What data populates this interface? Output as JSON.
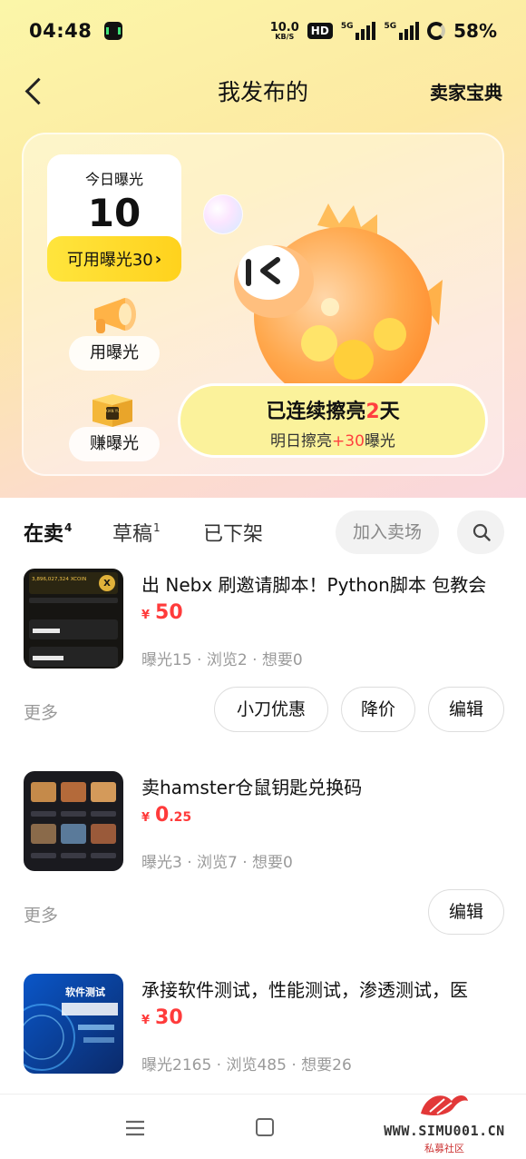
{
  "status_bar": {
    "time": "04:48",
    "net_speed_value": "10.0",
    "net_speed_unit": "KB/S",
    "hd_badge": "HD",
    "signal1_label": "5G",
    "signal2_label": "5G",
    "battery": "58%"
  },
  "nav": {
    "title": "我发布的",
    "seller_guide": "卖家宝典"
  },
  "promo": {
    "today_label": "今日曝光",
    "today_value": "10",
    "available_label": "可用曝光30",
    "available_arrow": "›",
    "use_label": "用曝光",
    "earn_label": "赚曝光",
    "box_text": "XIAN YU",
    "streak_prefix": "已连续擦亮",
    "streak_days": "2",
    "streak_suffix": "天",
    "tomorrow_prefix": "明日擦亮",
    "tomorrow_bonus": "+30",
    "tomorrow_suffix": "曝光"
  },
  "tabs": [
    {
      "label": "在卖",
      "count": "4"
    },
    {
      "label": "草稿",
      "count": "1"
    },
    {
      "label": "已下架",
      "count": ""
    }
  ],
  "join_market": "加入卖场",
  "listings": [
    {
      "title": "出 Nebx 刷邀请脚本！Python脚本 包教会",
      "currency": "¥",
      "price": "50",
      "price_decimal": "",
      "stats": "曝光15 · 浏览2 · 想要0",
      "more": "更多",
      "buttons": [
        "小刀优惠",
        "降价",
        "编辑"
      ],
      "thumb_text": "3,896,027,324 XCOIN"
    },
    {
      "title": "卖hamster仓鼠钥匙兑换码",
      "currency": "¥",
      "price": "0",
      "price_decimal": ".25",
      "stats": "曝光3 · 浏览7 · 想要0",
      "more": "更多",
      "buttons": [
        "编辑"
      ]
    },
    {
      "title": "承接软件测试，性能测试，渗透测试，医",
      "currency": "¥",
      "price": "30",
      "price_decimal": "",
      "stats": "曝光2165 · 浏览485 · 想要26",
      "thumb_text": "软件测试"
    }
  ],
  "watermark": {
    "text": "WWW.SIMU001.CN",
    "sub": "私募社区"
  },
  "colors": {
    "accent_yellow": "#ffe33a",
    "price_red": "#ff3b3b",
    "header_gradient_start": "#fbf6a8",
    "header_gradient_end": "#fad7de"
  }
}
